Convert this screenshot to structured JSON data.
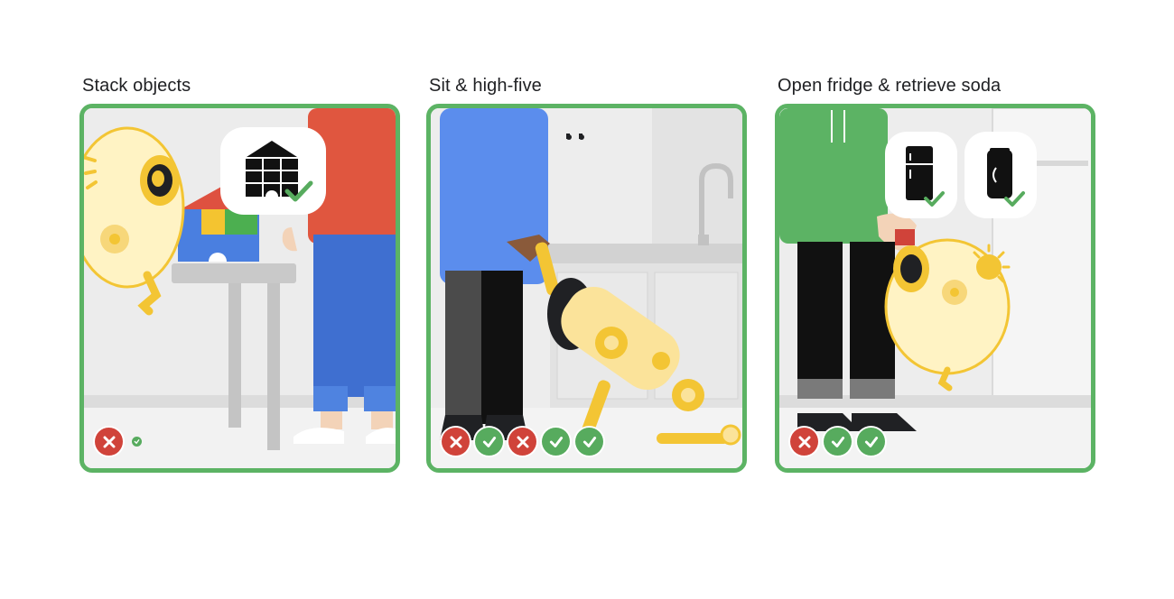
{
  "colors": {
    "frame": "#5cb364",
    "fail": "#d0433a",
    "success": "#57ab5e",
    "robot": "#f3c534",
    "shirt_red": "#e0563f",
    "sweater_blue": "#5b8ded",
    "hoodie_green": "#5cb364"
  },
  "panels": [
    {
      "title": "Stack objects",
      "icons": [
        "block-house-icon",
        "check-icon"
      ],
      "trials": [
        "fail",
        "success"
      ]
    },
    {
      "title": "Sit & high-five",
      "icons": [
        "dog-bowl-icon"
      ],
      "trials": [
        "fail",
        "success",
        "fail",
        "success",
        "success"
      ]
    },
    {
      "title": "Open fridge & retrieve soda",
      "icons": [
        "fridge-icon",
        "soda-can-icon",
        "check-icon"
      ],
      "trials": [
        "fail",
        "success",
        "success"
      ]
    }
  ]
}
